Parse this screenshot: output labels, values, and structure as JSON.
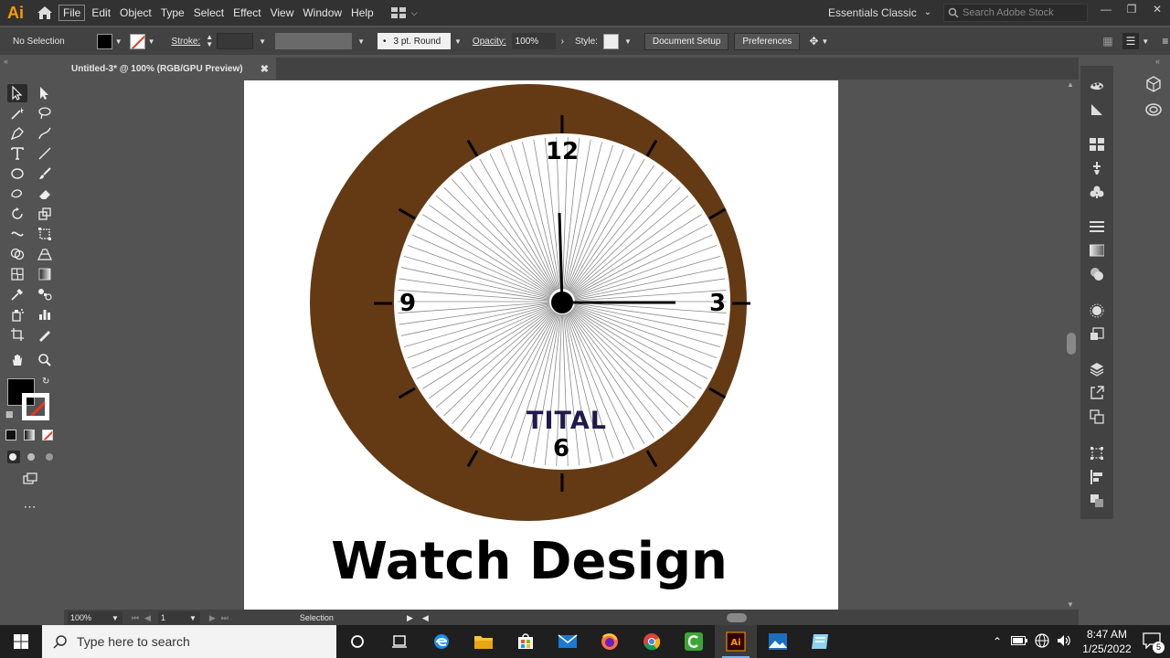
{
  "app": {
    "logo": "Ai",
    "menus": [
      "File",
      "Edit",
      "Object",
      "Type",
      "Select",
      "Effect",
      "View",
      "Window",
      "Help"
    ],
    "workspace": "Essentials Classic",
    "stock_search_placeholder": "Search Adobe Stock"
  },
  "control_bar": {
    "selection": "No Selection",
    "stroke_label": "Stroke:",
    "brush": "3 pt. Round",
    "opacity_label": "Opacity:",
    "opacity_value": "100%",
    "style_label": "Style:",
    "document_setup": "Document Setup",
    "preferences": "Preferences"
  },
  "document": {
    "tab_title": "Untitled-3* @ 100% (RGB/GPU Preview)"
  },
  "artwork": {
    "numbers": {
      "twelve": "12",
      "three": "3",
      "six": "6",
      "nine": "9"
    },
    "brand": "TITAL",
    "title": "Watch Design",
    "colors": {
      "bezel": "#643a14",
      "brand": "#1f1a4d",
      "ink": "#000000"
    }
  },
  "status_bar": {
    "zoom": "100%",
    "page": "1",
    "tool": "Selection"
  },
  "taskbar": {
    "search_placeholder": "Type here to search",
    "time": "8:47 AM",
    "date": "1/25/2022",
    "notification_count": "5"
  }
}
